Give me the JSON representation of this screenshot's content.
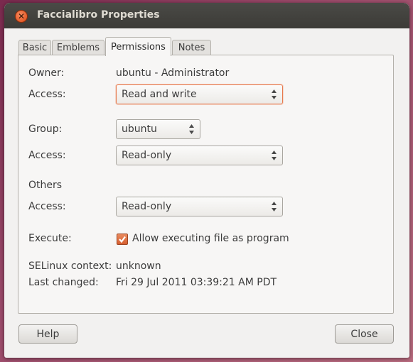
{
  "window": {
    "title": "Faccialibro Properties"
  },
  "tabs": [
    {
      "label": "Basic"
    },
    {
      "label": "Emblems"
    },
    {
      "label": "Permissions"
    },
    {
      "label": "Notes"
    }
  ],
  "permissions": {
    "owner_label": "Owner:",
    "owner_value": "ubuntu - Administrator",
    "owner_access_label": "Access:",
    "owner_access_value": "Read and write",
    "group_label": "Group:",
    "group_value": "ubuntu",
    "group_access_label": "Access:",
    "group_access_value": "Read-only",
    "others_label": "Others",
    "others_access_label": "Access:",
    "others_access_value": "Read-only",
    "execute_label": "Execute:",
    "execute_option": "Allow executing file as program",
    "execute_checked": true,
    "selinux_label": "SELinux context:",
    "selinux_value": "unknown",
    "last_changed_label": "Last changed:",
    "last_changed_value": "Fri 29 Jul 2011 03:39:21 AM PDT"
  },
  "buttons": {
    "help": "Help",
    "close": "Close"
  },
  "colors": {
    "accent": "#e7784b",
    "titlebar": "#3c3b37",
    "window_bg": "#f2f1f0"
  }
}
